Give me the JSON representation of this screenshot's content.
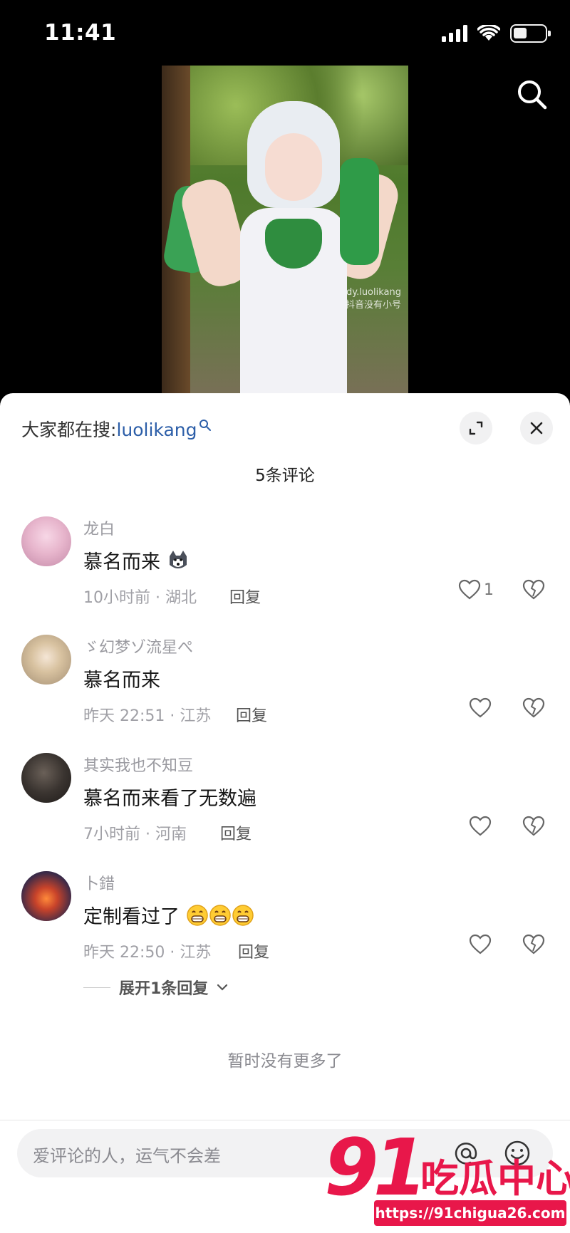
{
  "status_bar": {
    "time": "11:41"
  },
  "video": {
    "watermark_line1": "dy.luolikang",
    "watermark_line2": "抖音没有小号"
  },
  "comments_panel": {
    "hot_search_prefix": "大家都在搜:",
    "hot_search_keyword": "luolikang",
    "count_label": "5条评论",
    "comments": [
      {
        "user": "龙白",
        "text": "慕名而来",
        "emoji": "husky-emoji",
        "meta": "10小时前 · 湖北",
        "reply": "回复",
        "likes": "1"
      },
      {
        "user": "ゞ幻梦ゾ流星ぺ",
        "text": "慕名而来",
        "meta": "昨天 22:51 · 江苏",
        "reply": "回复",
        "likes": ""
      },
      {
        "user": "其实我也不知豆",
        "text": "慕名而来看了无数遍",
        "meta": "7小时前 · 河南",
        "reply": "回复",
        "likes": ""
      },
      {
        "user": "卜錯",
        "text": "定制看过了",
        "emoji": "grin-emoji x3",
        "meta": "昨天 22:50 · 江苏",
        "reply": "回复",
        "likes": ""
      }
    ],
    "expand_replies": "展开1条回复",
    "no_more": "暂时没有更多了"
  },
  "input": {
    "placeholder": "爱评论的人，运气不会差"
  },
  "watermark": {
    "logo_number": "91",
    "logo_text": "吃瓜中心",
    "url": "https://91chigua26.com"
  },
  "colors": {
    "accent": "#e8174a",
    "link": "#2c5ea8"
  }
}
